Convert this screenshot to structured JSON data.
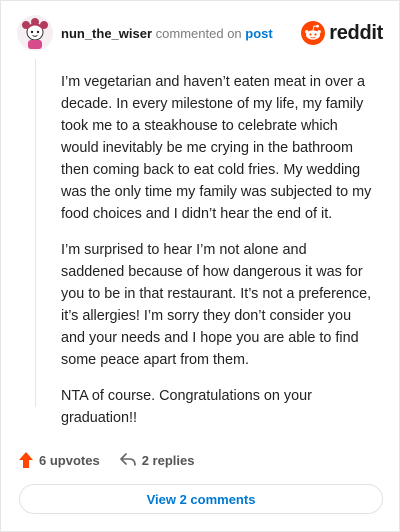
{
  "comment": {
    "username": "nun_the_wiser",
    "action_text": "commented on",
    "post_link": "post",
    "paragraphs": [
      "I’m vegetarian and haven’t eaten meat in over a decade. In every milestone of my life, my family took me to a steakhouse to celebrate which would inevitably be me crying in the bathroom then coming back to eat cold fries. My wedding was the only time my family was subjected to my food choices and I didn’t hear the end of it.",
      "I’m surprised to hear I’m not alone and saddened because of how dangerous it was for you to be in that restaurant. It’s not a preference, it’s allergies! I’m sorry they don’t consider you and your needs and I hope you are able to find some peace apart from them.",
      "NTA of course. Congratulations on your graduation!!"
    ]
  },
  "brand": {
    "name": "reddit",
    "icon": "reddit-logo-icon",
    "color": "#ff4500"
  },
  "actions": {
    "upvotes_label": "6 upvotes",
    "replies_label": "2 replies",
    "upvote_icon": "upvote-arrow-icon",
    "reply_icon": "reply-arrow-icon",
    "upvote_color": "#ff4500"
  },
  "view_comments_label": "View 2 comments",
  "link_color": "#0079d3"
}
